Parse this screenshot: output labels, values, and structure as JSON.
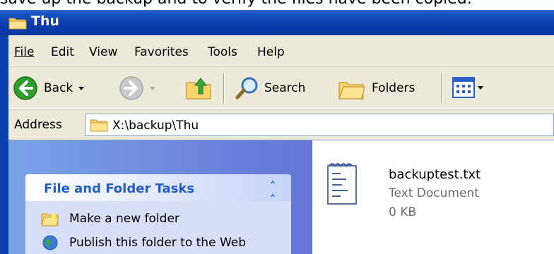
{
  "caption": "save up the backup and to verify the files have been copied:",
  "window": {
    "title": "Thu"
  },
  "menu": {
    "items": [
      "File",
      "Edit",
      "View",
      "Favorites",
      "Tools",
      "Help"
    ]
  },
  "toolbar": {
    "back_label": "Back",
    "search_label": "Search",
    "folders_label": "Folders"
  },
  "address": {
    "label": "Address",
    "value": "X:\\backup\\Thu"
  },
  "tasks": {
    "title": "File and Folder Tasks",
    "items": [
      "Make a new folder",
      "Publish this folder to the Web"
    ]
  },
  "file": {
    "name": "backuptest.txt",
    "type": "Text Document",
    "size": "0 KB"
  },
  "colors": {
    "titlebar": "#0b3fae",
    "task_link": "#215dc6",
    "panel": "#6375d6"
  }
}
